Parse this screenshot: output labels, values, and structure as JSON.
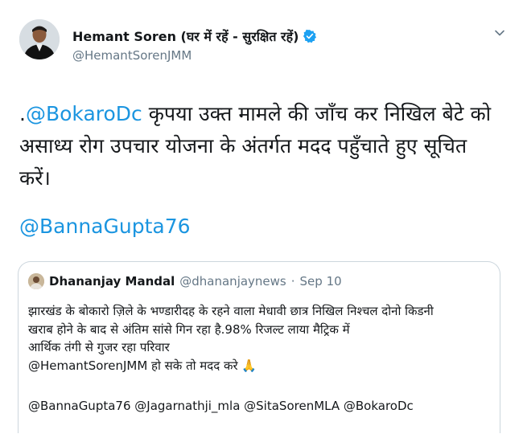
{
  "author": {
    "name": "Hemant Soren (घर में रहें - सुरक्षित रहें)",
    "handle": "@HemantSorenJMM"
  },
  "tweet": {
    "prefix": ".",
    "mention_1": "@BokaroDc",
    "line_1_rest": " कृपया उक्त मामले की जाँच कर निखिल बेटे को",
    "line_2": "असाध्य रोग उपचार योजना के अंतर्गत मदद पहुँचाते हुए सूचित",
    "line_3": "करें।",
    "mention_2": "@BannaGupta76"
  },
  "quoted": {
    "name": "Dhananjay Mandal",
    "handle": "@dhananjaynews",
    "separator": "·",
    "date": "Sep 10",
    "lines": [
      "झारखंड के बोकारो ज़िले के भण्डारीदह के रहने वाला मेधावी छात्र निखिल निश्चल दोनो किडनी",
      "खराब होने के बाद से अंतिम सांसे गिन रहा है.98% रिजल्ट लाया मैट्रिक में",
      "आर्थिक तंगी से गुजर रहा परिवार",
      "@HemantSorenJMM हो सके तो मदद करे 🙏"
    ],
    "mentions": "@BannaGupta76 @Jagarnathji_mla @SitaSorenMLA @BokaroDc"
  },
  "colors": {
    "link": "#1b95e0",
    "text": "#14171a",
    "muted": "#657786",
    "verified": "#1da1f2",
    "border": "#ccd6dd"
  },
  "icons": {
    "verified": "verified-badge-icon",
    "caret": "chevron-down-icon"
  }
}
